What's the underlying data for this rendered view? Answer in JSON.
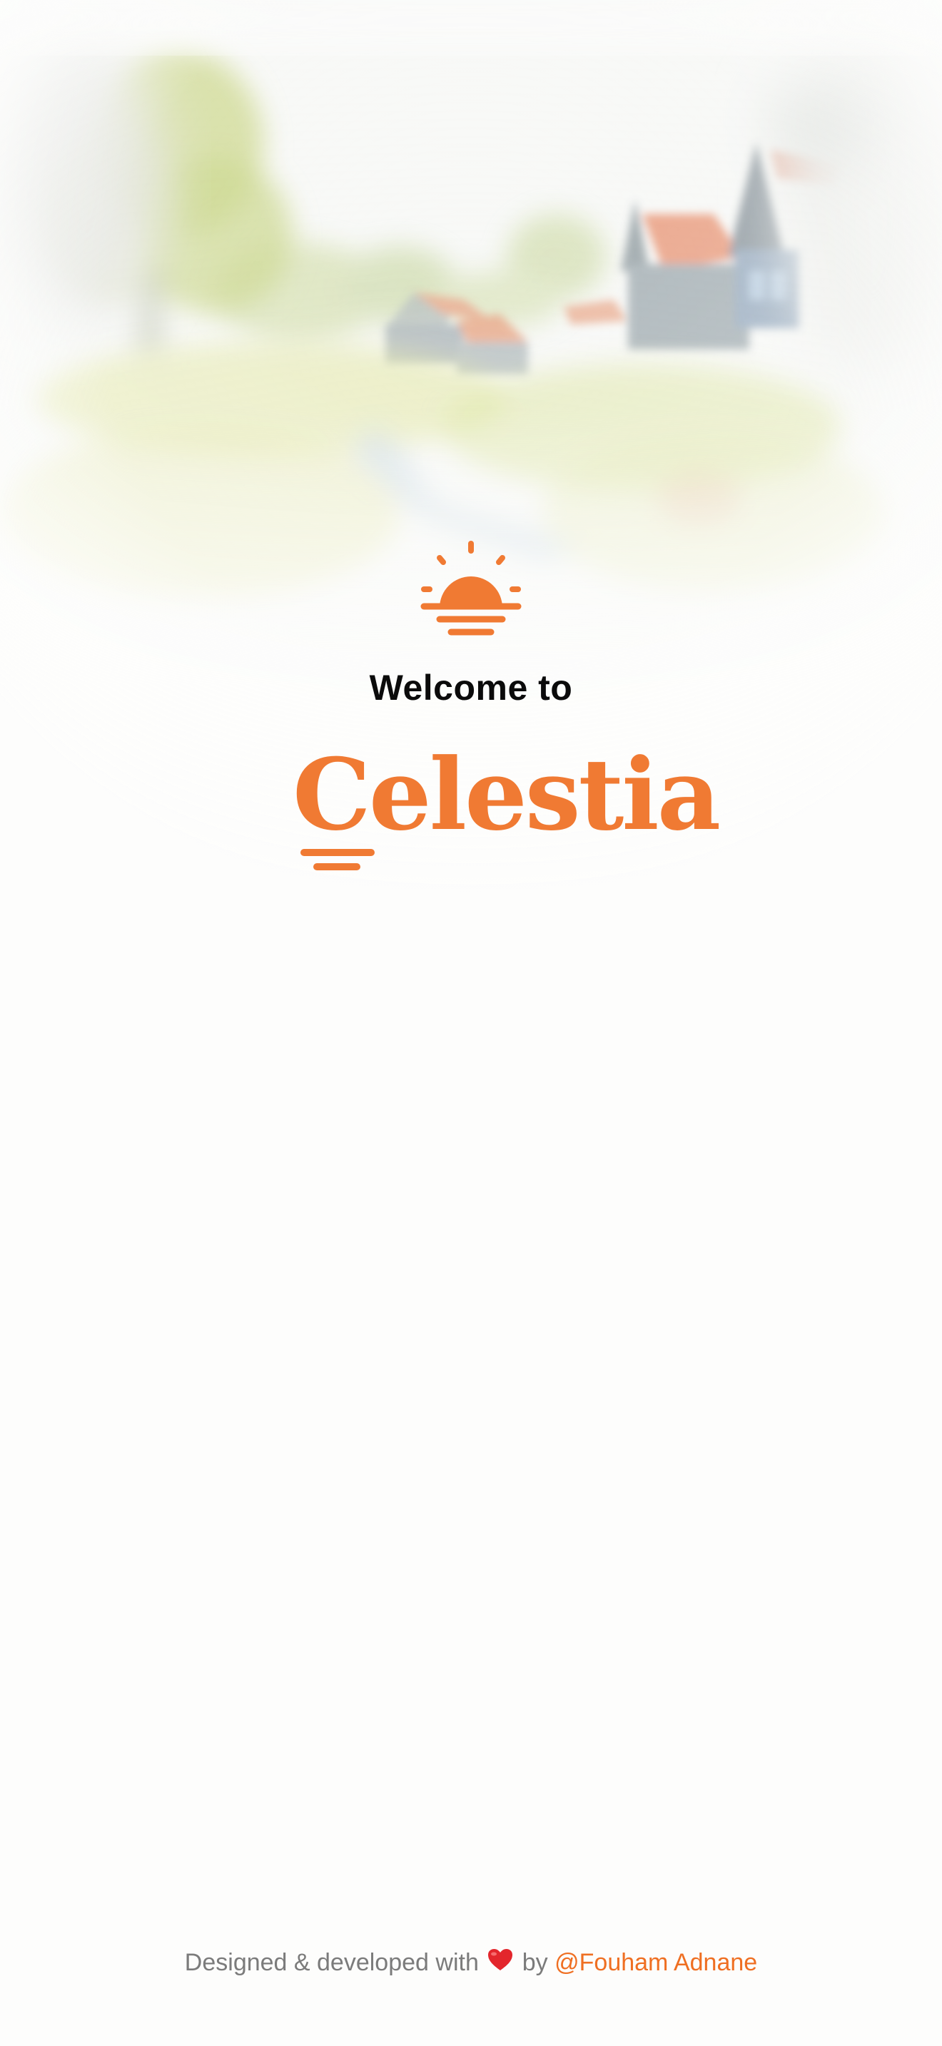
{
  "welcome_text": "Welcome to",
  "brand_name": "Celestia",
  "footer": {
    "prefix": "Designed & developed with",
    "heart_icon": "heart-icon",
    "by": "by",
    "author": "@Fouham Adnane"
  },
  "colors": {
    "accent": "#f07a33",
    "author_link": "#ef6f22",
    "heading": "#0b0b0b",
    "footer_text": "#7b7b7b",
    "background": "#fdfdfc"
  },
  "icons": {
    "logo": "sunrise-icon"
  }
}
